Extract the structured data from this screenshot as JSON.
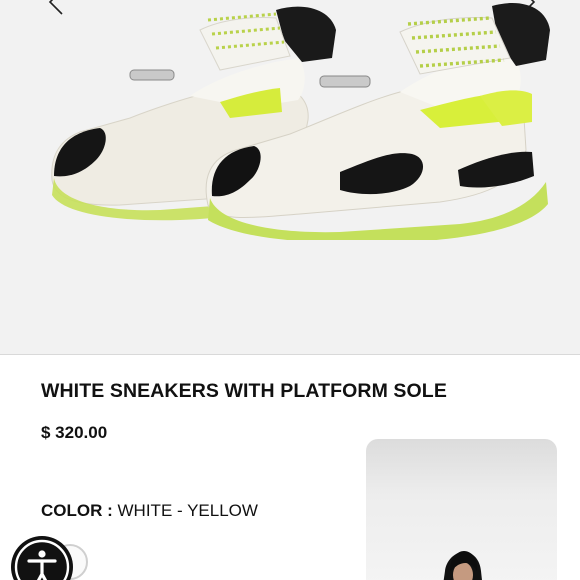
{
  "gallery": {
    "image_alt": "White sneakers with platform sole product photo",
    "prev_icon": "chevron-left-icon",
    "next_icon": "chevron-right-icon"
  },
  "product": {
    "title": "WHITE SNEAKERS WITH PLATFORM SOLE",
    "price": "$ 320.00",
    "color_label": "COLOR :",
    "color_value": "WHITE - YELLOW"
  },
  "accessibility": {
    "icon": "accessibility-icon"
  },
  "colors": {
    "accent_lime": "#c8e63c",
    "sole_black": "#111111",
    "upper_white": "#f3f1ea",
    "text": "#111111"
  }
}
